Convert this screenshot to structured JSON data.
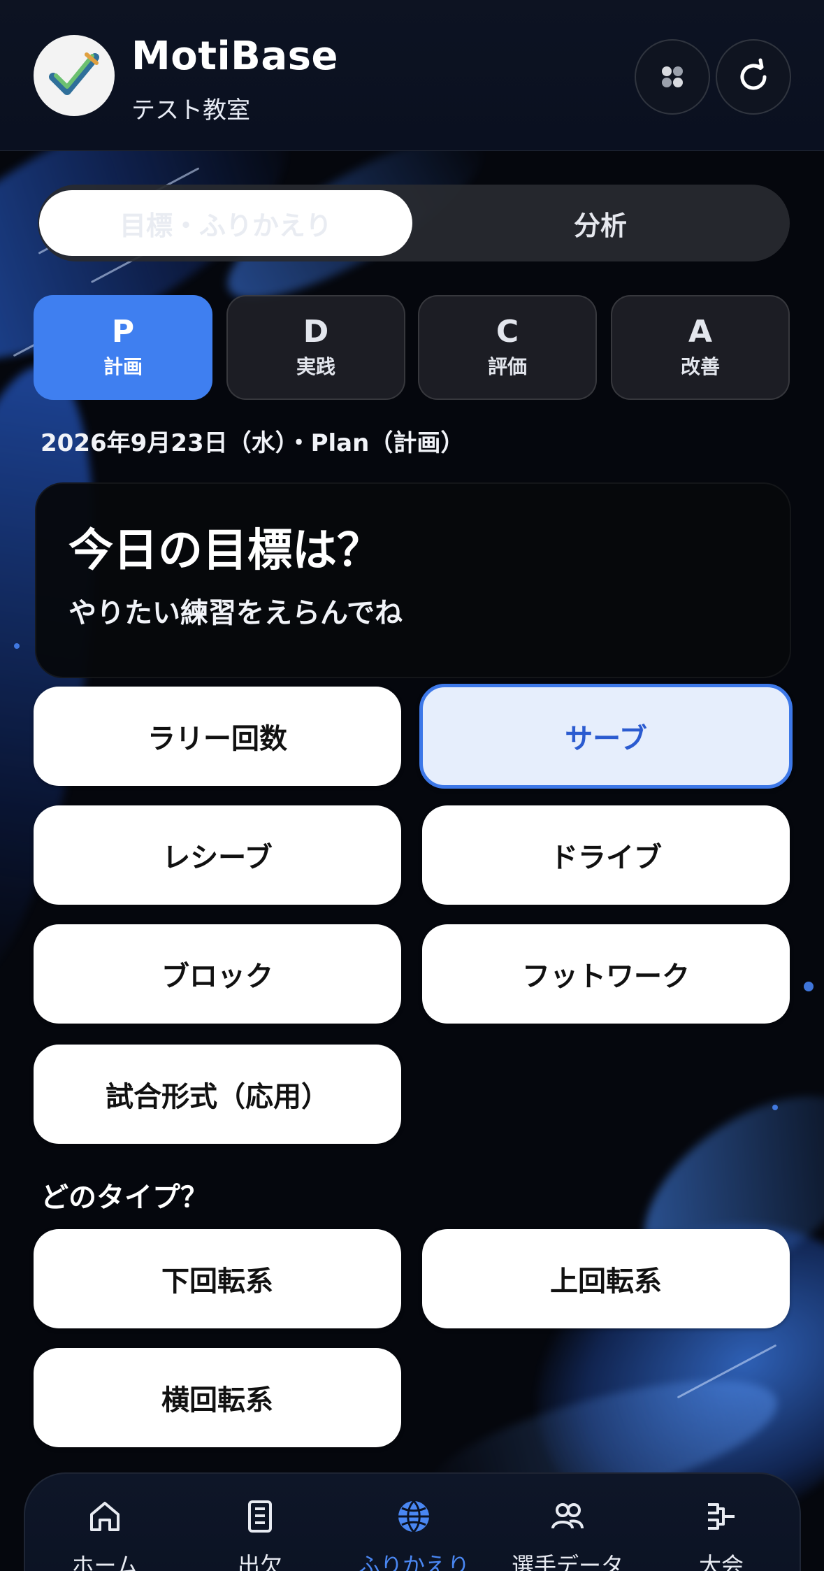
{
  "header": {
    "app_name": "MotiBase",
    "classroom": "テスト教室"
  },
  "mode_tabs": {
    "goals_label": "目標・ふりかえり",
    "analysis_label": "分析"
  },
  "pdca": [
    {
      "letter": "P",
      "label": "計画"
    },
    {
      "letter": "D",
      "label": "実践"
    },
    {
      "letter": "C",
      "label": "評価"
    },
    {
      "letter": "A",
      "label": "改善"
    }
  ],
  "date_line": "2026年9月23日（水）・Plan（計画）",
  "card": {
    "title": "今日の目標は？",
    "subtitle": "やりたい練習をえらんでね"
  },
  "practice_options": [
    {
      "label": "ラリー回数"
    },
    {
      "label": "サーブ"
    },
    {
      "label": "レシーブ"
    },
    {
      "label": "ドライブ"
    },
    {
      "label": "ブロック"
    },
    {
      "label": "フットワーク"
    },
    {
      "label": "試合形式（応用）"
    }
  ],
  "selected_practice": "サーブ",
  "type_section": {
    "title": "どのタイプ？",
    "options": [
      {
        "label": "下回転系"
      },
      {
        "label": "上回転系"
      },
      {
        "label": "横回転系"
      }
    ]
  },
  "bottom_nav": [
    {
      "label": "ホーム",
      "icon": "home-icon"
    },
    {
      "label": "出欠",
      "icon": "attendance-icon"
    },
    {
      "label": "ふりかえり",
      "icon": "globe-icon"
    },
    {
      "label": "選手データ",
      "icon": "players-icon"
    },
    {
      "label": "大会",
      "icon": "tournament-icon"
    }
  ],
  "active_nav": "ふりかえり",
  "colors": {
    "accent": "#3f7ff0",
    "background": "#05070d",
    "selected_border": "#3d78e8"
  }
}
